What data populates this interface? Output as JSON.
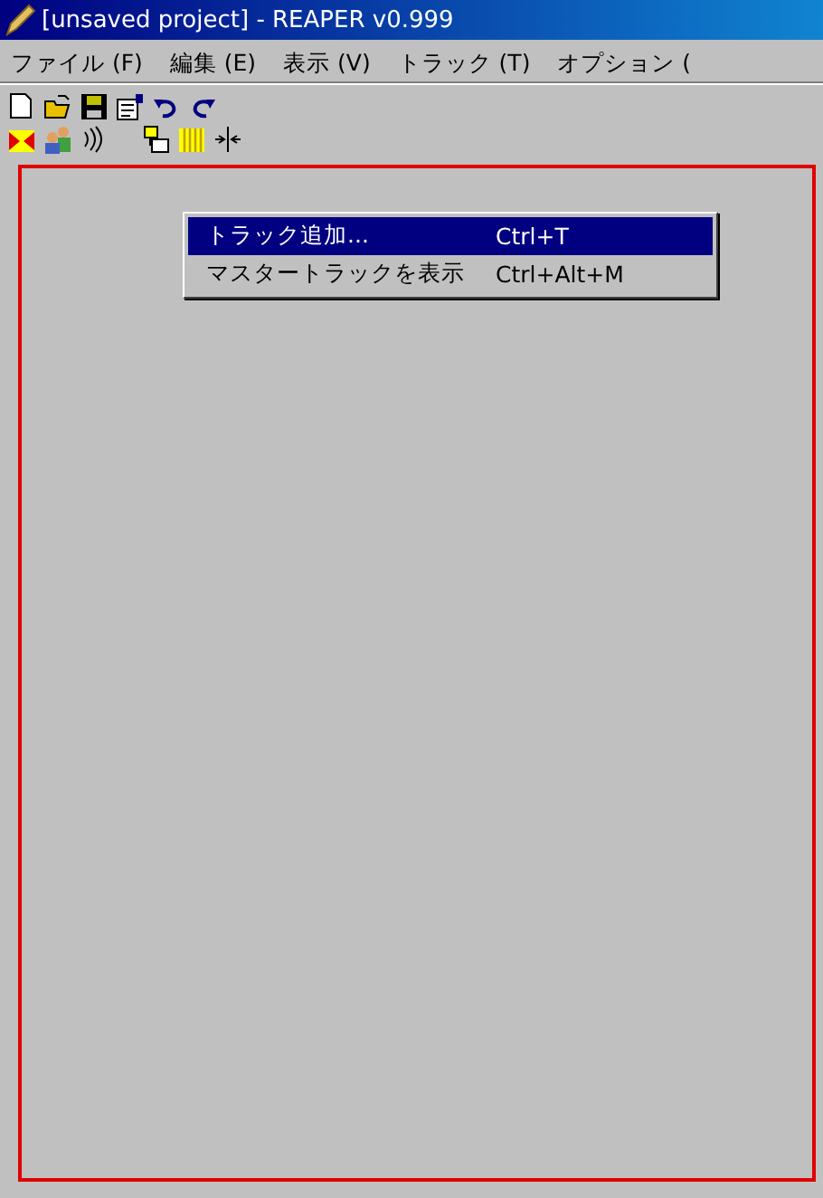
{
  "window": {
    "title": "[unsaved project] - REAPER v0.999"
  },
  "menubar": [
    "ファイル (F)",
    "編集 (E)",
    "表示 (V)",
    "トラック (T)",
    "オプション ("
  ],
  "context_menu": [
    {
      "label": "トラック追加...",
      "shortcut": "Ctrl+T",
      "selected": true
    },
    {
      "label": "マスタートラックを表示",
      "shortcut": "Ctrl+Alt+M",
      "selected": false
    }
  ]
}
